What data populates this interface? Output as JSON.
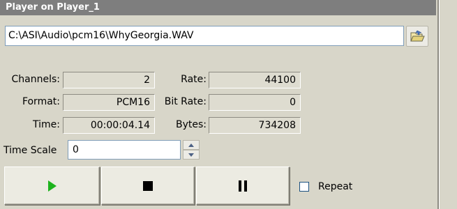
{
  "window": {
    "title": "Player on Player_1"
  },
  "file": {
    "path": "C:\\ASI\\Audio\\pcm16\\WhyGeorgia.WAV"
  },
  "info": {
    "channels_label": "Channels:",
    "channels_value": "2",
    "format_label": "Format:",
    "format_value": "PCM16",
    "time_label": "Time:",
    "time_value": "00:00:04.14",
    "rate_label": "Rate:",
    "rate_value": "44100",
    "bitrate_label": "Bit Rate:",
    "bitrate_value": "0",
    "bytes_label": "Bytes:",
    "bytes_value": "734208"
  },
  "timescale": {
    "label": "Time Scale",
    "value": "0"
  },
  "transport": {
    "play_icon": "play-icon",
    "stop_icon": "stop-icon",
    "pause_icon": "pause-icon"
  },
  "repeat": {
    "label": "Repeat",
    "checked": false
  },
  "colors": {
    "play": "#1db31d",
    "title_bg": "#7e7e7e"
  }
}
